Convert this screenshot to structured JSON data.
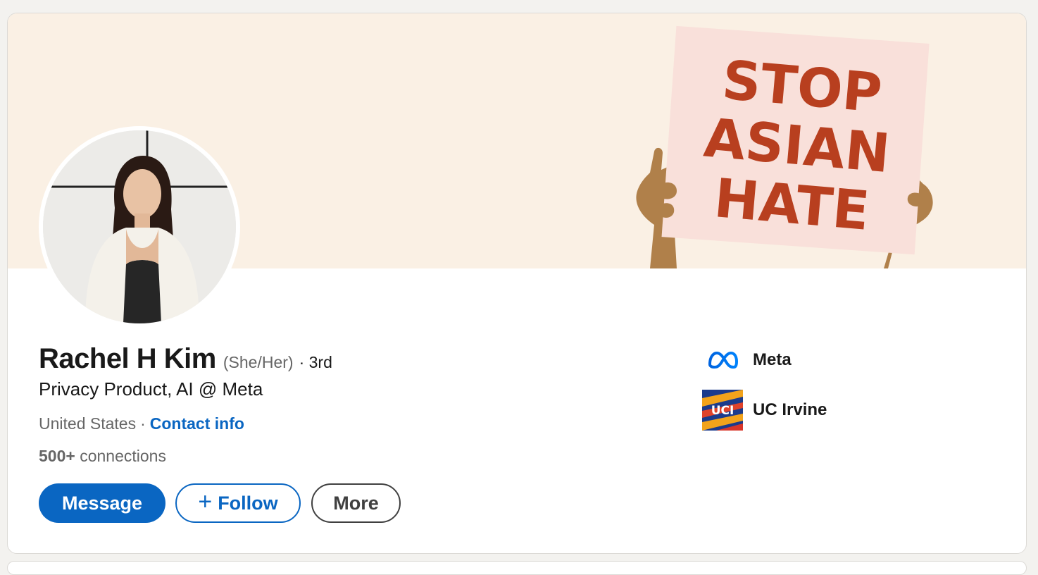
{
  "profile": {
    "name": "Rachel H Kim",
    "pronouns": "(She/Her)",
    "degree": "· 3rd",
    "headline": "Privacy Product, AI @ Meta",
    "location": "United States",
    "separator": "·",
    "contact_label": "Contact info",
    "connections_count": "500+",
    "connections_label": "connections"
  },
  "banner": {
    "sign_lines": [
      "STOP",
      "ASIAN",
      "HATE"
    ],
    "colors": {
      "background": "#faf0e4",
      "sign": "#f9e0da",
      "text": "#b83f1f",
      "hands": "#b0804a"
    }
  },
  "actions": {
    "message": "Message",
    "follow": "Follow",
    "more": "More"
  },
  "orgs": [
    {
      "name": "Meta",
      "icon": "meta-logo-icon"
    },
    {
      "name": "UC Irvine",
      "icon": "uci-logo-icon",
      "logo_text": "UCI"
    }
  ],
  "colors": {
    "accent": "#0a66c2",
    "text": "#191919",
    "muted": "#666666"
  }
}
